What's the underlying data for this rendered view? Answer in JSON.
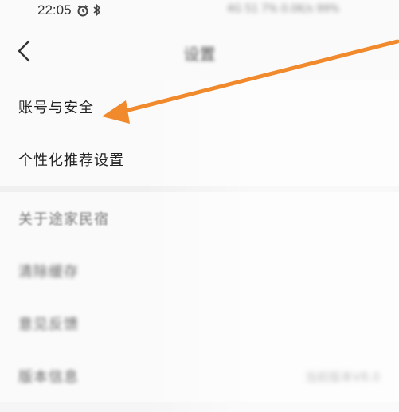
{
  "status_bar": {
    "time": "22:05",
    "icons": [
      "alarm-icon",
      "bluetooth-icon"
    ],
    "right_text": "4G 51 7% 0.0K/s 99%"
  },
  "nav": {
    "back_icon": "chevron-left-icon",
    "title": "设置"
  },
  "settings": {
    "items": [
      {
        "label": "账号与安全"
      },
      {
        "label": "个性化推荐设置"
      },
      {
        "label": "关于途家民宿"
      },
      {
        "label": "清除缓存"
      },
      {
        "label": "意见反馈"
      },
      {
        "label": "版本信息",
        "value": "当前版本V8.0"
      }
    ]
  },
  "annotation": {
    "arrow_color": "#f08a2c"
  }
}
